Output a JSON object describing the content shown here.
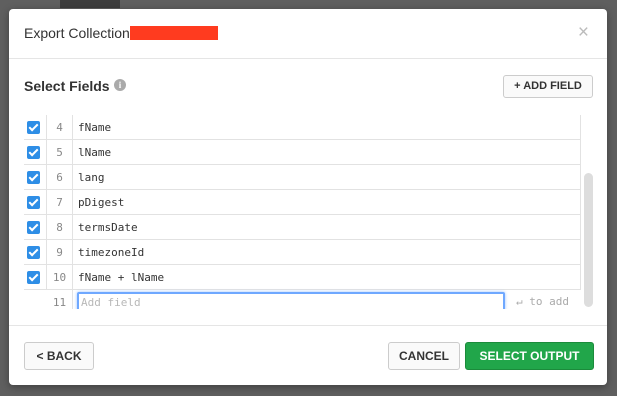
{
  "dialog": {
    "title": "Export Collection",
    "close_icon": "×"
  },
  "section": {
    "title": "Select Fields",
    "info_icon": "i",
    "add_field_label": "+ ADD FIELD"
  },
  "fields": [
    {
      "num": "4",
      "name": "fName",
      "checked": true
    },
    {
      "num": "5",
      "name": "lName",
      "checked": true
    },
    {
      "num": "6",
      "name": "lang",
      "checked": true
    },
    {
      "num": "7",
      "name": "pDigest",
      "checked": true
    },
    {
      "num": "8",
      "name": "termsDate",
      "checked": true
    },
    {
      "num": "9",
      "name": "timezoneId",
      "checked": true
    },
    {
      "num": "10",
      "name": "fName + lName",
      "checked": true
    }
  ],
  "new_field": {
    "num": "11",
    "placeholder": "Add field",
    "hint": "↵ to add"
  },
  "footer": {
    "back_label": "< BACK",
    "cancel_label": "CANCEL",
    "select_output_label": "SELECT OUTPUT"
  },
  "colors": {
    "primary": "#21a64a",
    "checkbox": "#2e8ee6",
    "redaction": "#ff3b1f"
  }
}
